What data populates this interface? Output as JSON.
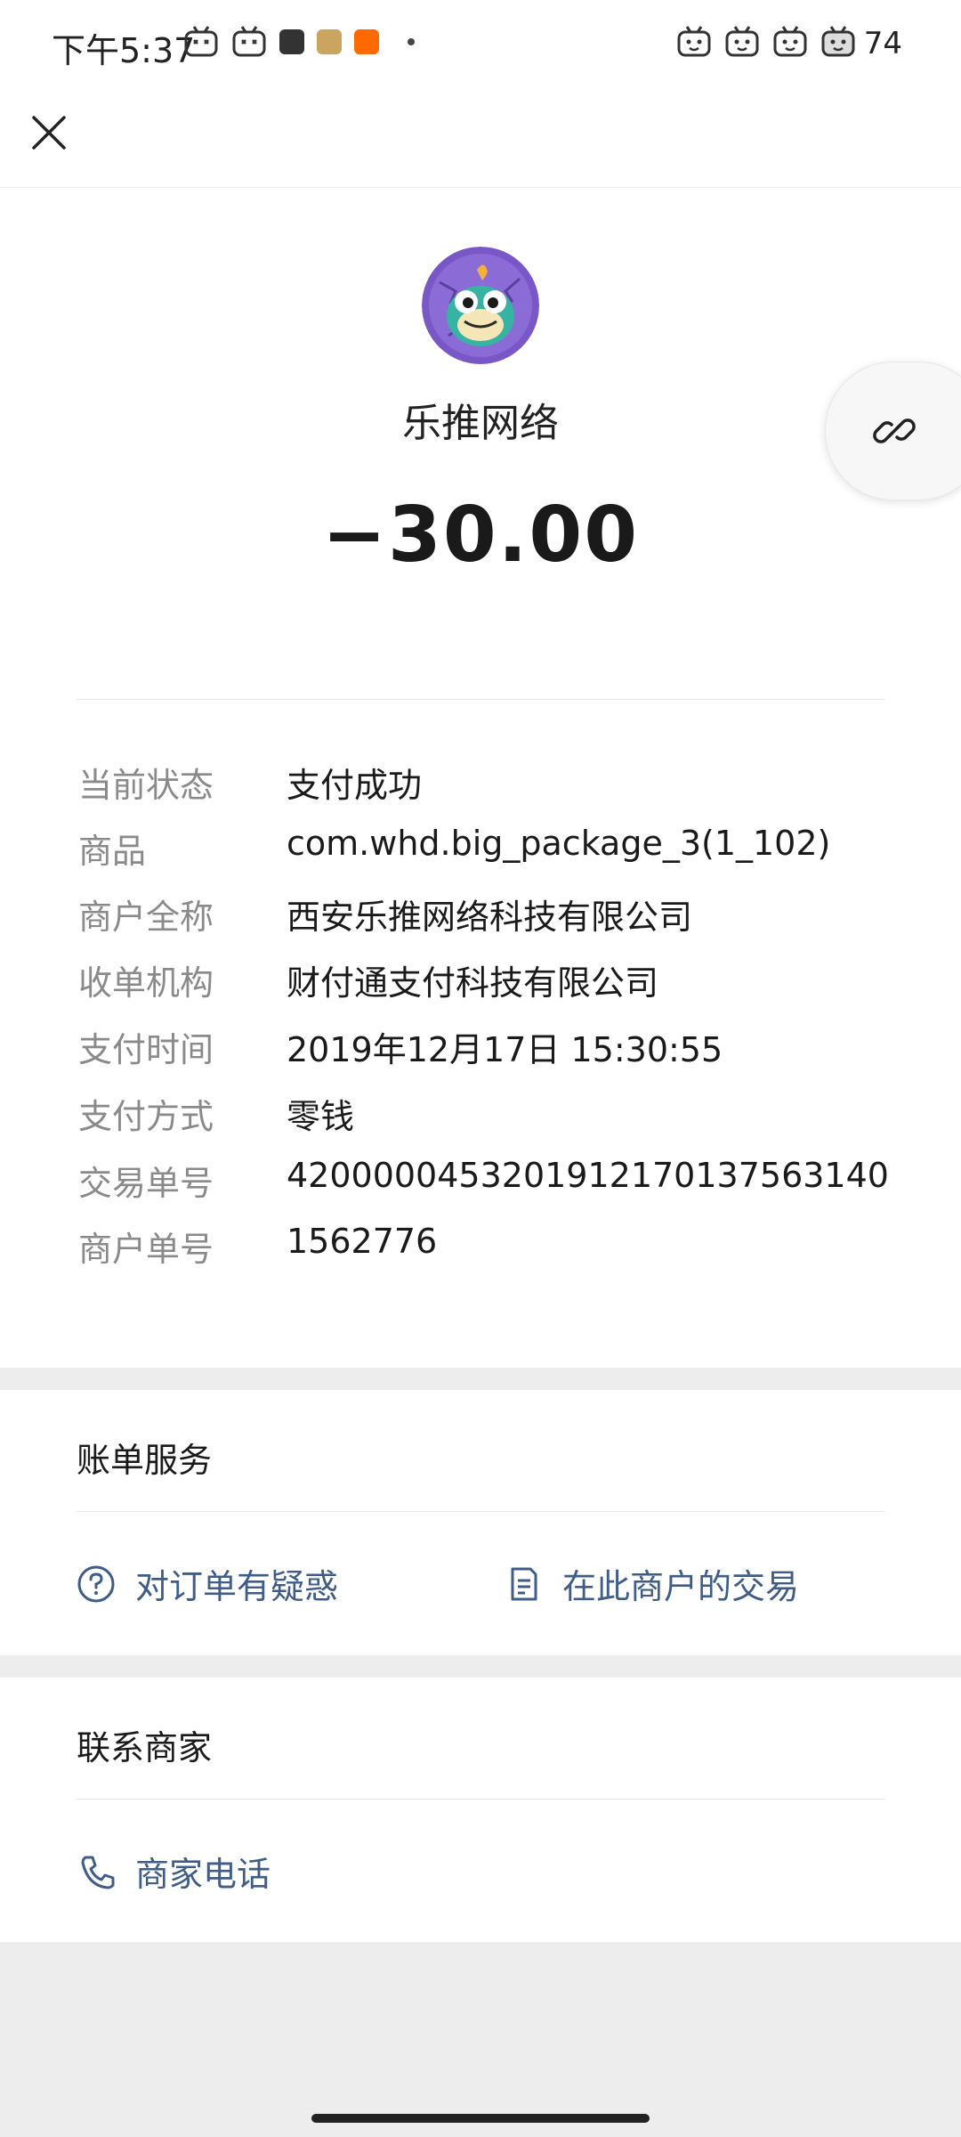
{
  "status_bar": {
    "time": "下午5:37",
    "battery": "74"
  },
  "merchant": {
    "name": "乐推网络",
    "amount": "−30.00"
  },
  "details": [
    {
      "label": "当前状态",
      "value": "支付成功"
    },
    {
      "label": "商品",
      "value": "com.whd.big_package_3(1_102)"
    },
    {
      "label": "商户全称",
      "value": "西安乐推网络科技有限公司"
    },
    {
      "label": "收单机构",
      "value": "财付通支付科技有限公司"
    },
    {
      "label": "支付时间",
      "value": "2019年12月17日 15:30:55"
    },
    {
      "label": "支付方式",
      "value": "零钱"
    },
    {
      "label": "交易单号",
      "value": "4200000453201912170137563140"
    },
    {
      "label": "商户单号",
      "value": "1562776"
    }
  ],
  "bill_service": {
    "title": "账单服务",
    "question_label": "对订单有疑惑",
    "merchant_tx_label": "在此商户的交易"
  },
  "contact": {
    "title": "联系商家",
    "phone_label": "商家电话"
  },
  "icons": {
    "close": "close-icon",
    "link": "link-icon",
    "question": "question-circle-icon",
    "document": "document-icon",
    "phone": "phone-icon"
  },
  "colors": {
    "link_text": "#3f5d86",
    "label_gray": "#8a8a8a",
    "background": "#ededed"
  }
}
